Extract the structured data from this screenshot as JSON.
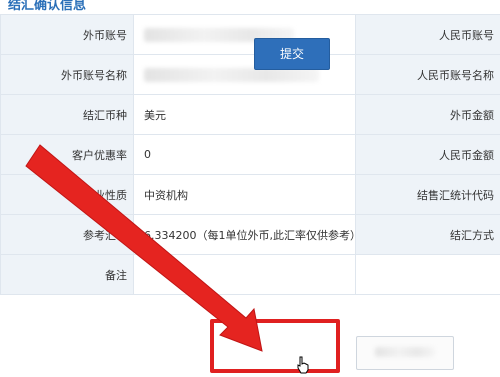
{
  "header": {
    "title": "结汇确认信息"
  },
  "rows": [
    {
      "left_label": "外币账号",
      "left_value": "",
      "right_label": "人民币账号"
    },
    {
      "left_label": "外币账号名称",
      "left_value": "",
      "right_label": "人民币账号名称"
    },
    {
      "left_label": "结汇币种",
      "left_value": "美元",
      "right_label": "外币金额"
    },
    {
      "left_label": "客户优惠率",
      "left_value": "0",
      "right_label": "人民币金额"
    },
    {
      "left_label": "企业性质",
      "left_value": "中资机构",
      "right_label": "结售汇统计代码"
    },
    {
      "left_label": "参考汇率",
      "left_value": "6.334200（每1单位外币,此汇率仅供参考）",
      "right_label": "结汇方式"
    },
    {
      "left_label": "备注",
      "left_value": "",
      "right_label": ""
    }
  ],
  "buttons": {
    "submit": "提交",
    "cancel": ""
  },
  "colors": {
    "label_bg": "#eef3f8",
    "accent": "#2e6fba",
    "annotation": "#e02020"
  },
  "icons": {
    "annotation_arrow": "red-arrow-icon",
    "cursor": "hand-cursor-icon"
  }
}
